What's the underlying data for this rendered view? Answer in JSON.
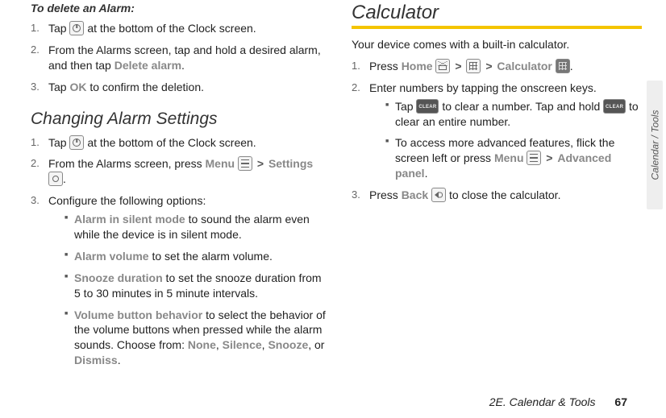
{
  "side_tab": "Calendar / Tools",
  "footer": {
    "section": "2E. Calendar & Tools",
    "page": "67"
  },
  "left": {
    "delete_head": "To delete an Alarm:",
    "delete_steps": [
      {
        "n": "1.",
        "pre": "Tap ",
        "post": " at the bottom of the Clock screen."
      },
      {
        "n": "2.",
        "text_a": "From the Alarms screen, tap and hold a desired alarm, and then tap ",
        "term": "Delete alarm",
        "text_b": "."
      },
      {
        "n": "3.",
        "text_a": "Tap ",
        "term": "OK",
        "text_b": " to confirm the deletion."
      }
    ],
    "change_head": "Changing Alarm Settings",
    "change_steps": [
      {
        "n": "1.",
        "pre": "Tap ",
        "post": " at the bottom of the Clock screen."
      },
      {
        "n": "2.",
        "text_a": "From the Alarms screen, press ",
        "term1": "Menu",
        "gt": ">",
        "term2": "Settings",
        "text_b": "."
      },
      {
        "n": "3.",
        "text": "Configure the following options:"
      }
    ],
    "options": [
      {
        "term": "Alarm in silent mode",
        "text": " to sound the alarm even while the device is in silent mode."
      },
      {
        "term": "Alarm volume",
        "text": " to set the alarm volume."
      },
      {
        "term": "Snooze duration",
        "text": " to set the snooze duration from 5 to 30 minutes in 5 minute intervals."
      },
      {
        "term": "Volume button behavior",
        "text_a": " to select the behavior of the volume buttons when pressed while the alarm sounds. Choose from: ",
        "opts": [
          "None",
          "Silence",
          "Snooze",
          "Dismiss"
        ],
        "text_b": "."
      }
    ]
  },
  "right": {
    "head": "Calculator",
    "intro": "Your device comes with a built-in calculator.",
    "steps": {
      "s1": {
        "n": "1.",
        "pre": "Press ",
        "home": "Home",
        "gt": ">",
        "calc": "Calculator",
        "post": "."
      },
      "s2": {
        "n": "2.",
        "text": "Enter numbers by tapping the onscreen keys."
      },
      "s2_bullets": [
        {
          "pre": "Tap ",
          "mid": " to clear a number. Tap and hold ",
          "post": " to clear an entire number."
        },
        {
          "pre": "To access more advanced features, flick the screen left or press ",
          "menu": "Menu",
          "gt": ">",
          "adv": "Advanced panel",
          "post": "."
        }
      ],
      "s3": {
        "n": "3.",
        "pre": "Press ",
        "back": "Back",
        "post": " to close the calculator."
      }
    }
  }
}
